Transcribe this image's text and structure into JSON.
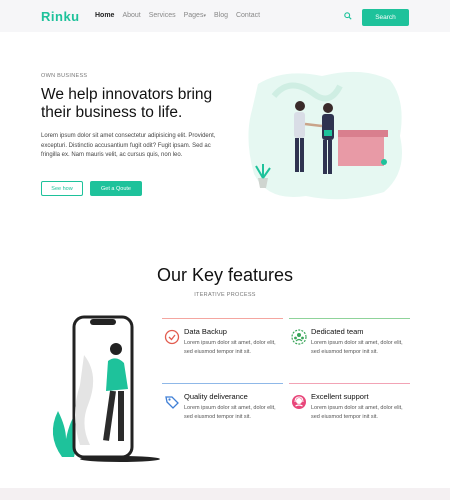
{
  "brand": {
    "logo": "Rinku",
    "accent": "#1ec29b"
  },
  "nav": {
    "items": [
      {
        "label": "Home"
      },
      {
        "label": "About"
      },
      {
        "label": "Services"
      },
      {
        "label": "Pages"
      },
      {
        "label": "Blog"
      },
      {
        "label": "Contact"
      }
    ],
    "search_label": "Search",
    "icons": {
      "search": "search-icon",
      "pages_caret": "caret-down-icon"
    }
  },
  "hero": {
    "eyebrow": "OWN BUSINESS",
    "title": "We help innovators bring their business to life.",
    "text": "Lorem ipsum dolor sit amet consectetur adipisicing elit. Provident, excepturi. Distinctio accusantium fugit odit? Fugit ipsam. Sed ac fringilla ex. Nam mauris velit, ac cursus quis, non leo.",
    "btn_outline": "See how",
    "btn_solid": "Get a Qoute",
    "illustration": "business-handshake-illustration"
  },
  "features": {
    "title": "Our Key features",
    "subtitle": "ITERATIVE PROCESS",
    "illustration": "phone-woman-illustration",
    "cards": [
      {
        "title": "Data Backup",
        "text": "Lorem ipsum dolor sit amet, dolor elit, sed eiusmod tempor init sit.",
        "icon": "data-backup-icon",
        "color": "#f4a6a0"
      },
      {
        "title": "Dedicated team",
        "text": "Lorem ipsum dolor sit amet, dolor elit, sed eiusmod tempor init sit.",
        "icon": "team-icon",
        "color": "#8fd39a"
      },
      {
        "title": "Quality deliverance",
        "text": "Lorem ipsum dolor sit amet, dolor elit, sed eiusmod tempor init sit.",
        "icon": "quality-tag-icon",
        "color": "#8fb8e8"
      },
      {
        "title": "Excellent support",
        "text": "Lorem ipsum dolor sit amet, dolor elit, sed eiusmod tempor init sit.",
        "icon": "support-headset-icon",
        "color": "#f2a3b5"
      }
    ]
  }
}
